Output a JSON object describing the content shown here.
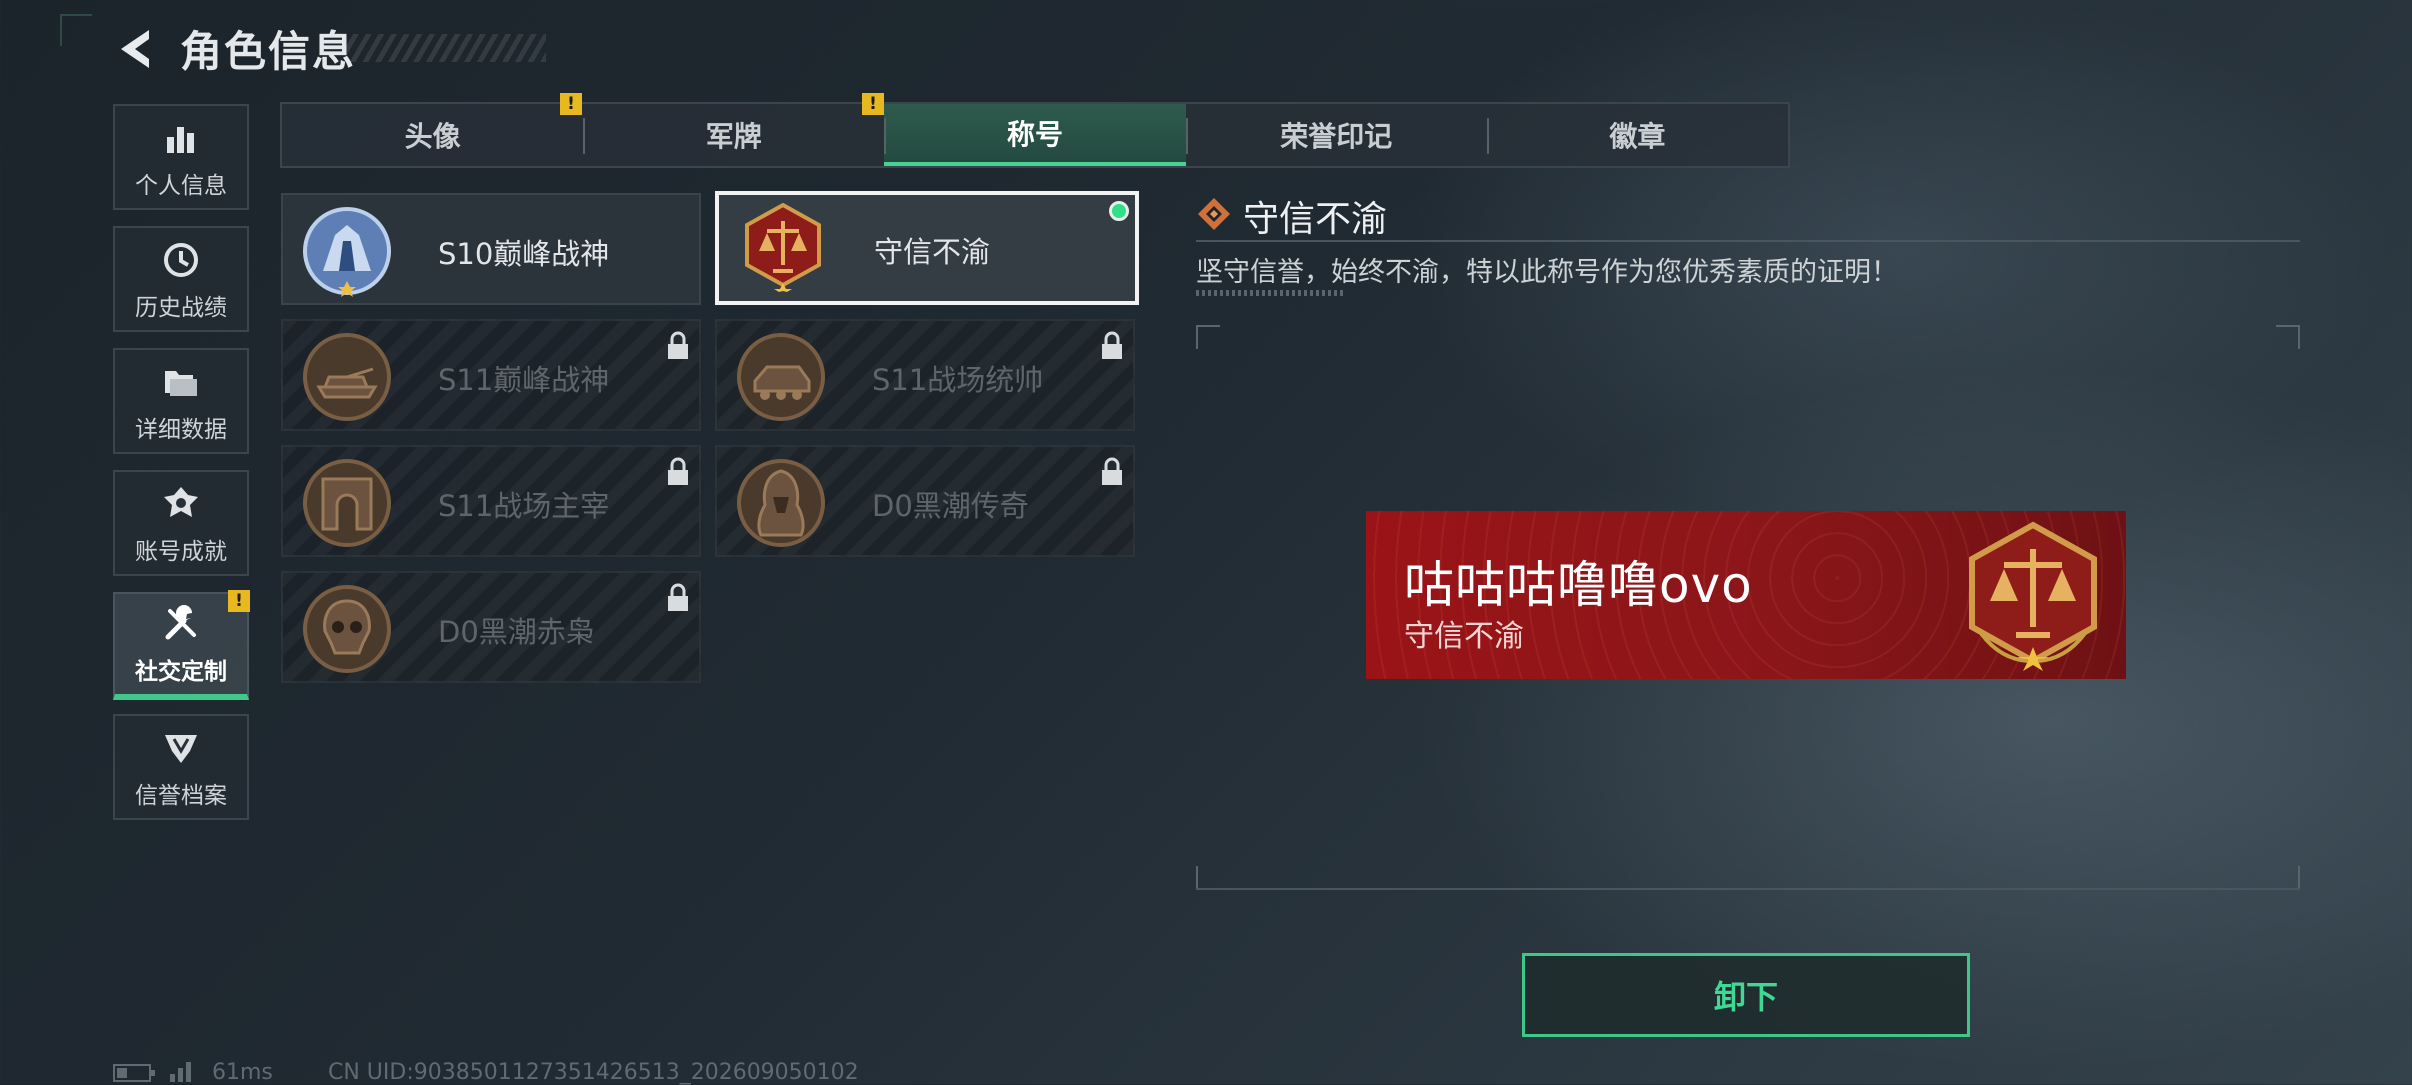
{
  "header": {
    "title": "角色信息"
  },
  "sidebar": {
    "items": [
      {
        "label": "个人信息",
        "icon": "bar-chart-icon"
      },
      {
        "label": "历史战绩",
        "icon": "history-clock-icon"
      },
      {
        "label": "详细数据",
        "icon": "folder-icon"
      },
      {
        "label": "账号成就",
        "icon": "achievement-icon"
      },
      {
        "label": "社交定制",
        "icon": "wrench-screwdriver-icon",
        "active": true,
        "alert": "!"
      },
      {
        "label": "信誉档案",
        "icon": "credibility-shield-icon"
      }
    ]
  },
  "tabs": [
    {
      "label": "头像",
      "alert": "!"
    },
    {
      "label": "军牌",
      "alert": "!"
    },
    {
      "label": "称号",
      "active": true
    },
    {
      "label": "荣誉印记"
    },
    {
      "label": "徽章"
    }
  ],
  "titles": [
    {
      "name": "S10巅峰战神",
      "locked": false
    },
    {
      "name": "守信不渝",
      "locked": false,
      "selected": true,
      "equipped": true
    },
    {
      "name": "S11巅峰战神",
      "locked": true
    },
    {
      "name": "S11战场统帅",
      "locked": true
    },
    {
      "name": "S11战场主宰",
      "locked": true
    },
    {
      "name": "D0黑潮传奇",
      "locked": true
    },
    {
      "name": "D0黑潮赤枭",
      "locked": true
    }
  ],
  "detail": {
    "title": "守信不渝",
    "description": "坚守信誉，始终不渝，特以此称号作为您优秀素质的证明！"
  },
  "nameplate": {
    "player_name": "咕咕咕噜噜ovo",
    "title": "守信不渝",
    "background_color": "#9a1417"
  },
  "actions": {
    "unequip_label": "卸下"
  },
  "status_bar": {
    "ping": "61ms",
    "uid": "CN UID:903850112735142651​3_202609050102"
  },
  "colors": {
    "accent": "#3fc88a",
    "alert": "#e8b820",
    "equipped": "#2fe08a"
  }
}
